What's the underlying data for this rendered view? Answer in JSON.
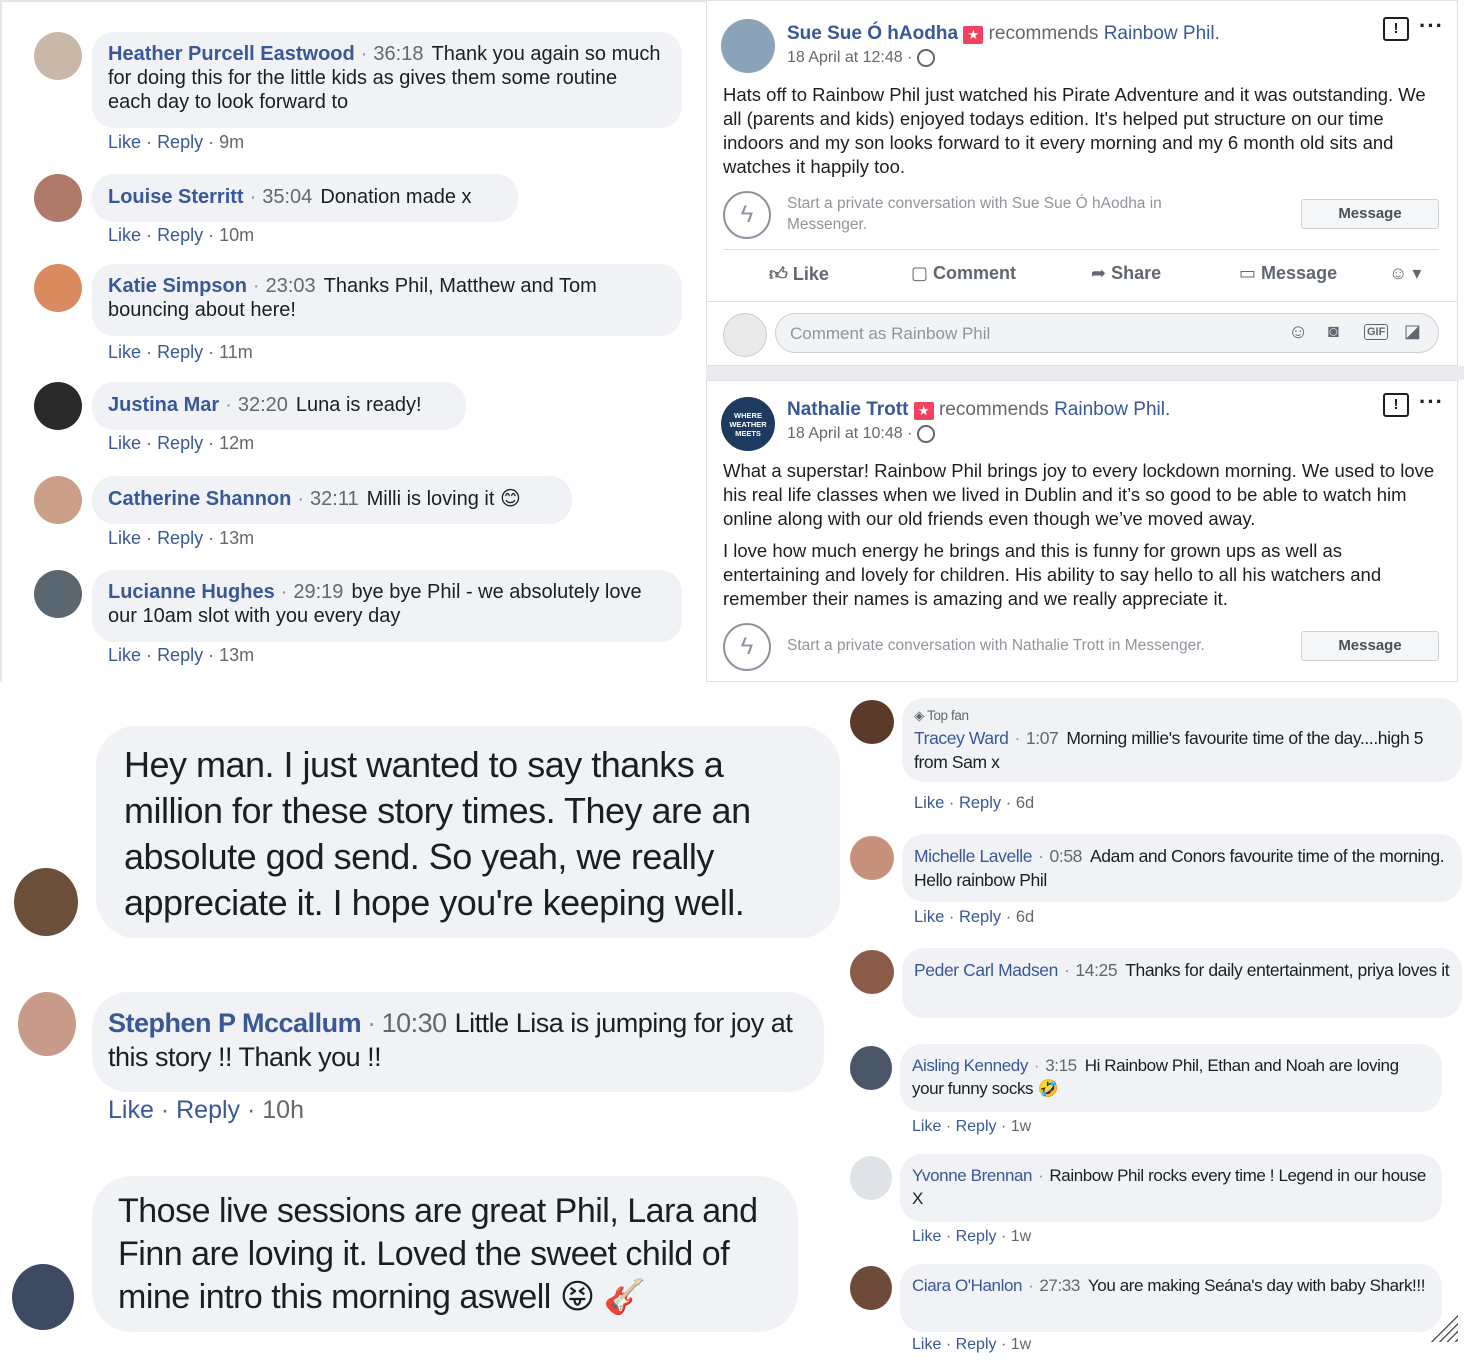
{
  "left_comments": [
    {
      "name": "Heather Purcell Eastwood",
      "time": "36:18",
      "text": "Thank you again so much for doing this for the little kids as gives them some routine each day to look forward to",
      "age": "9m",
      "avatar_color": "#c9b8a8"
    },
    {
      "name": "Louise Sterritt",
      "time": "35:04",
      "text": "Donation made x",
      "age": "10m",
      "avatar_color": "#b07a6a"
    },
    {
      "name": "Katie Simpson",
      "time": "23:03",
      "text": "Thanks Phil, Matthew and Tom bouncing about here!",
      "age": "11m",
      "avatar_color": "#d98b5f"
    },
    {
      "name": "Justina Mar",
      "time": "32:20",
      "text": "Luna is ready!",
      "age": "12m",
      "avatar_color": "#2a2a2a"
    },
    {
      "name": "Catherine Shannon",
      "time": "32:11",
      "text": "Milli is loving it 😊",
      "age": "13m",
      "avatar_color": "#caa088"
    },
    {
      "name": "Lucianne Hughes",
      "time": "29:19",
      "text": "bye bye Phil - we absolutely love our 10am slot with you every day",
      "age": "13m",
      "avatar_color": "#5a6670"
    }
  ],
  "actions": {
    "like": "Like",
    "reply": "Reply",
    "dot": "·"
  },
  "posts": [
    {
      "author": "Sue Sue Ó hAodha",
      "verb": "recommends",
      "page": "Rainbow Phil.",
      "date": "18 April at 12:48 ·",
      "body": [
        "Hats off to Rainbow Phil just watched his Pirate Adventure and it was outstanding. We all (parents and kids) enjoyed todays edition. It's helped put structure on our time indoors and my son looks forward to it every morning and my 6 month old sits and watches it happily too."
      ],
      "messenger_prompt": "Start a private conversation with Sue Sue Ó hAodha in Messenger.",
      "message_btn": "Message"
    },
    {
      "author": "Nathalie Trott",
      "verb": "recommends",
      "page": "Rainbow Phil.",
      "date": "18 April at 10:48 ·",
      "body": [
        "What a superstar! Rainbow Phil brings joy to every lockdown morning. We used to love his real life classes when we lived in Dublin and it’s so good to be able to watch him online along with our old friends even though we’ve moved away.",
        "I love how much energy he brings and this is funny for grown ups as well as entertaining and lovely for children. His ability to say hello to all his watchers and remember their names is amazing and we really appreciate it."
      ],
      "messenger_prompt": "Start a private conversation with Nathalie Trott in Messenger.",
      "message_btn": "Message",
      "avatar_text": "WHERE WEATHER MEETS"
    }
  ],
  "post_actions": {
    "like": "Like",
    "comment": "Comment",
    "share": "Share",
    "message": "Message"
  },
  "comment_box": {
    "placeholder": "Comment as Rainbow Phil",
    "gif": "GIF"
  },
  "big_comments": [
    {
      "text": "Hey man. I just wanted to say thanks a million for these story times. They are an absolute god send. So yeah, we really appreciate it. I hope you're keeping well."
    },
    {
      "name": "Stephen P Mccallum",
      "time": "10:30",
      "text": "Little Lisa is jumping for joy at this story !! Thank you !!",
      "age": "10h"
    },
    {
      "text": "Those live sessions are great Phil, Lara and Finn are loving it. Loved the sweet child of mine intro this morning aswell 😝 🎸"
    }
  ],
  "right_comments": [
    {
      "badge": "Top fan",
      "name": "Tracey Ward",
      "time": "1:07",
      "text": "Morning millie's favourite time of the day....high 5 from Sam x",
      "age": "6d"
    },
    {
      "name": "Michelle Lavelle",
      "time": "0:58",
      "text": "Adam and Conors favourite time of the morning. Hello rainbow Phil",
      "age": "6d"
    },
    {
      "name": "Peder Carl Madsen",
      "time": "14:25",
      "text": "Thanks for daily entertainment, priya loves it"
    },
    {
      "name": "Aisling Kennedy",
      "time": "3:15",
      "text": "Hi Rainbow Phil, Ethan and Noah are loving your funny socks 🤣",
      "age": "1w"
    },
    {
      "name": "Yvonne Brennan",
      "text": "Rainbow Phil rocks every time ! Legend in our house X",
      "age": "1w"
    },
    {
      "name": "Ciara O'Hanlon",
      "time": "27:33",
      "text": "You are making Seána's day with baby Shark!!!",
      "age": "1w"
    }
  ],
  "colors": {
    "link": "#385898",
    "bubble": "#f0f2f5",
    "muted": "#65676b"
  }
}
